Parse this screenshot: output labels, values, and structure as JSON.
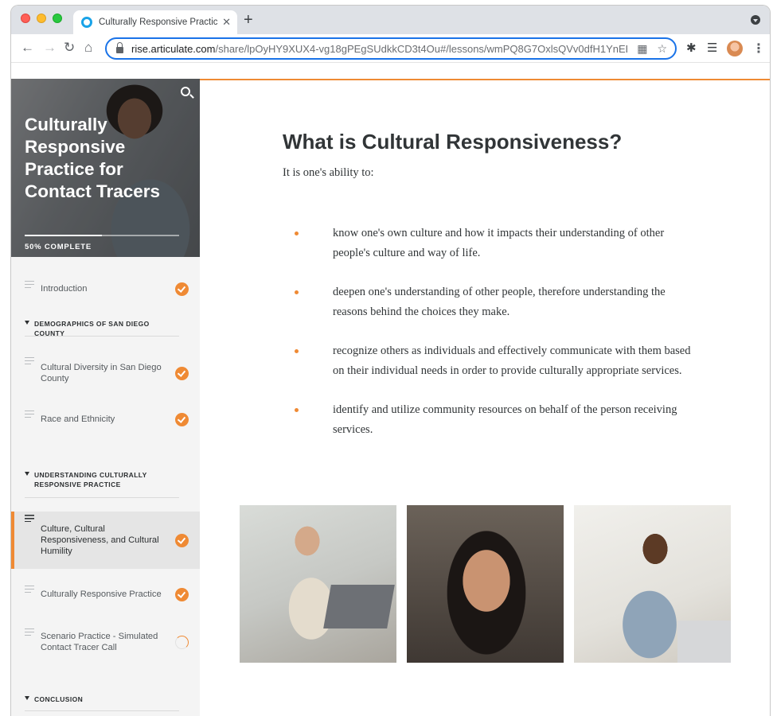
{
  "browser": {
    "tab_title": "Culturally Responsive Practice",
    "tab_close": "✕",
    "new_tab": "+",
    "url_host": "rise.articulate.com",
    "url_path": "/share/lpOyHY9XUX4-vg18gPEgSUdkkCD3t4Ou#/lessons/wmPQ8G7OxlsQVv0dfH1YnEB-a...",
    "icons": [
      "back-arrow-icon",
      "forward-arrow-icon",
      "reload-icon",
      "home-icon",
      "lock-icon",
      "qr-code-icon",
      "star-icon",
      "puzzle-icon",
      "reading-list-icon",
      "profile-avatar",
      "kebab-menu-icon"
    ]
  },
  "sidebar": {
    "course_title": "Culturally Responsive Practice for Contact Tracers",
    "progress_label": "50% COMPLETE",
    "progress_fraction": 0.5,
    "items": [
      {
        "type": "lesson",
        "label": "Introduction",
        "status": "complete"
      },
      {
        "type": "section",
        "label": "DEMOGRAPHICS OF SAN DIEGO COUNTY"
      },
      {
        "type": "lesson",
        "label": "Cultural Diversity in San Diego County",
        "status": "complete"
      },
      {
        "type": "lesson",
        "label": "Race and Ethnicity",
        "status": "complete"
      },
      {
        "type": "section",
        "label": "UNDERSTANDING CULTURALLY RESPONSIVE PRACTICE"
      },
      {
        "type": "lesson",
        "label": "Culture, Cultural Responsiveness, and Cultural Humility",
        "status": "complete",
        "active": true
      },
      {
        "type": "lesson",
        "label": "Culturally Responsive Practice",
        "status": "complete"
      },
      {
        "type": "lesson",
        "label": "Scenario Practice - Simulated Contact Tracer Call",
        "status": "in-progress"
      },
      {
        "type": "section",
        "label": "CONCLUSION"
      }
    ]
  },
  "main": {
    "title": "What is Cultural Responsiveness?",
    "lead": "It is one's ability to:",
    "bullets": [
      "know one's own culture and how it impacts their understanding of other people's culture and way of life.",
      "deepen one's understanding of other people, therefore understanding the reasons behind the choices they make.",
      "recognize others as individuals and effectively communicate with them based on their individual needs in order to provide culturally appropriate services.",
      "identify and utilize community resources on behalf of the person receiving services."
    ]
  },
  "colors": {
    "accent": "#ef8a34",
    "sidebar_bg": "#f4f4f4",
    "text": "#313537"
  }
}
